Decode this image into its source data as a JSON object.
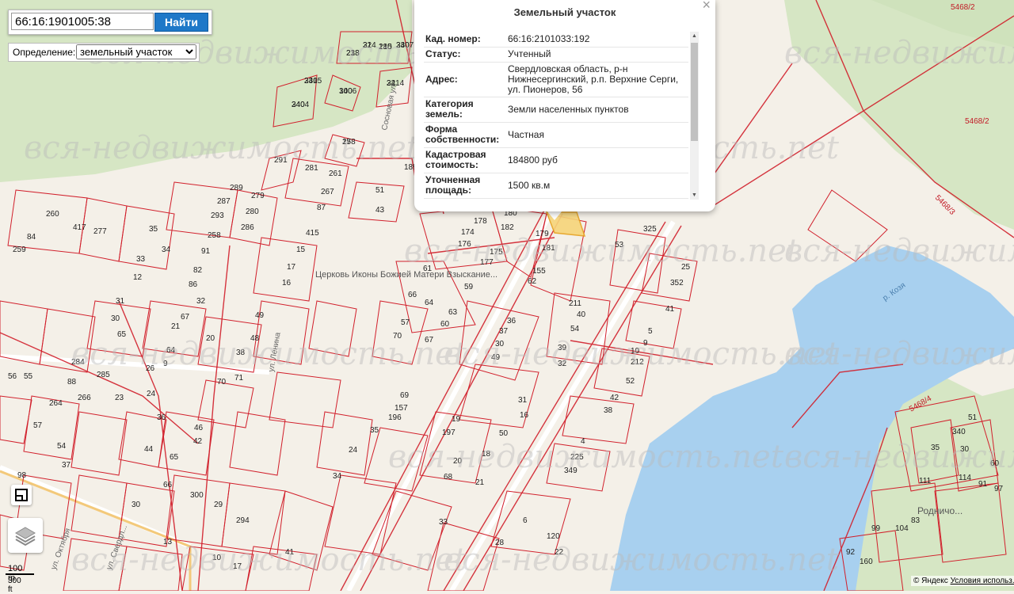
{
  "search": {
    "value": "66:16:1901005:38",
    "button_label": "Найти"
  },
  "definition": {
    "label": "Определение:",
    "selected": "земельный участок"
  },
  "popup": {
    "title": "Земельный участок",
    "rows": [
      {
        "key": "Кад. номер:",
        "value": "66:16:2101033:192"
      },
      {
        "key": "Статус:",
        "value": "Учтенный"
      },
      {
        "key": "Адрес:",
        "value": "Свердловская область, р-н Нижнесергинский, р.п. Верхние Серги, ул. Пионеров, 56"
      },
      {
        "key": "Категория земель:",
        "value": "Земли населенных пунктов"
      },
      {
        "key": "Форма собственности:",
        "value": "Частная"
      },
      {
        "key": "Кадастровая стоимость:",
        "value": "184800 руб"
      },
      {
        "key": "Уточненная площадь:",
        "value": "1500 кв.м"
      }
    ]
  },
  "map": {
    "watermark": "вся-недвижимость.net",
    "place_labels": {
      "church": "Церковь Иконы Божией Матери Взыскание...",
      "street_sosnovaya": "Сосновая ул.",
      "street_lenina": "ул. Ленина",
      "street_oktyabrya": "ул. Октября",
      "street_sverdlova": "ул. Свердл...",
      "river": "р. Козя",
      "village": "Родничо..."
    },
    "quarter_labels": [
      "5468/2",
      "5468/2",
      "5468/3",
      "5468/4"
    ],
    "parcel_numbers": [
      "213",
      "214",
      "215",
      "3407",
      "3405",
      "3404",
      "3406",
      "3414",
      "278",
      "291",
      "281",
      "261",
      "267",
      "87",
      "51",
      "43",
      "189",
      "260",
      "289",
      "279",
      "287",
      "280",
      "293",
      "286",
      "259",
      "84",
      "417",
      "277",
      "35",
      "34",
      "33",
      "258",
      "91",
      "82",
      "86",
      "32",
      "12",
      "31",
      "30",
      "65",
      "26",
      "21",
      "67",
      "20",
      "56",
      "55",
      "415",
      "15",
      "17",
      "16",
      "49",
      "48",
      "38",
      "71",
      "70",
      "64",
      "9",
      "285",
      "284",
      "88",
      "264",
      "266",
      "23",
      "24",
      "36",
      "46",
      "42",
      "44",
      "180",
      "178",
      "182",
      "179",
      "181",
      "174",
      "176",
      "175",
      "177",
      "155",
      "62",
      "61",
      "66",
      "64",
      "63",
      "59",
      "60",
      "57",
      "70",
      "67",
      "36",
      "37",
      "30",
      "49",
      "53",
      "325",
      "25",
      "352",
      "41",
      "211",
      "40",
      "54",
      "5",
      "9",
      "39",
      "10",
      "212",
      "32",
      "52",
      "42",
      "38",
      "4",
      "225",
      "349",
      "31",
      "16",
      "50",
      "18",
      "21",
      "20",
      "19",
      "197",
      "68",
      "69",
      "157",
      "196",
      "35",
      "34",
      "24",
      "33",
      "120",
      "22",
      "6",
      "28",
      "51",
      "340",
      "60",
      "35",
      "30",
      "97",
      "111",
      "114",
      "91",
      "99",
      "104",
      "83",
      "92",
      "160",
      "98",
      "57",
      "54",
      "65",
      "66",
      "300",
      "29",
      "294",
      "13",
      "10",
      "17",
      "41",
      "37",
      "30",
      "238",
      "32",
      "180",
      "230",
      "231",
      "240",
      "100",
      "22",
      "15"
    ]
  },
  "controls": {
    "ruler_icon": "ruler-icon",
    "layers_icon": "layers-icon"
  },
  "scale": {
    "metric": "100 m",
    "imperial": "300 ft"
  },
  "copyright": {
    "text": "© Яндекс",
    "link": "Условия использ..."
  }
}
